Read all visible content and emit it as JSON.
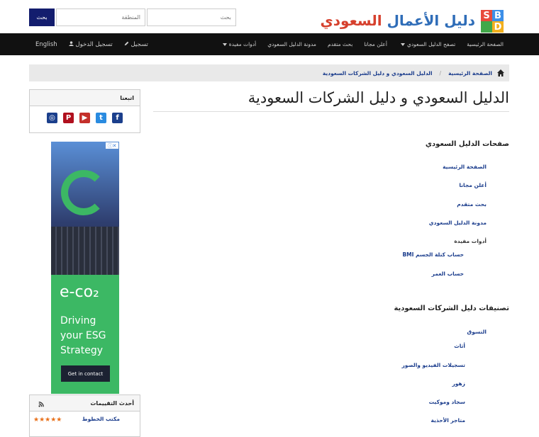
{
  "header": {
    "logo_part1": "دليل الأعمال",
    "logo_part2": "السعودي",
    "logo_letters": [
      "S",
      "B",
      "D",
      ""
    ],
    "search": {
      "query_placeholder": "بحث",
      "region_placeholder": "المنطقة",
      "button_label": "بحث"
    }
  },
  "nav": {
    "right_items": [
      {
        "label": "الصفحة الرئيسية",
        "dropdown": false
      },
      {
        "label": "تصفح الدليل السعودي",
        "dropdown": true
      },
      {
        "label": "أعلن مجانا",
        "dropdown": false
      },
      {
        "label": "بحث متقدم",
        "dropdown": false
      },
      {
        "label": "مدونة الدليل السعودي",
        "dropdown": false
      },
      {
        "label": "أدوات مفيدة",
        "dropdown": true
      }
    ],
    "english": "English",
    "login": "تسجيل الدخول",
    "register": "تسجيل"
  },
  "breadcrumb": {
    "home": "الصفحة الرئيسية",
    "current": "الدليل السعودي و دليل الشركات السعودية"
  },
  "main": {
    "title": "الدليل السعودي و دليل الشركات السعودية",
    "pages_heading": "صفحات الدليل السعودي",
    "pages_links": [
      "الصفحة الرئيسية",
      "أعلن مجانا",
      "بحث متقدم",
      "مدونة الدليل السعودي"
    ],
    "tools_label": "أدوات مفيدة",
    "tools_links": [
      "حساب كتلة الجسم BMI",
      "حساب العمر"
    ],
    "categories_heading": "تصنيفات دليل الشركات السعودية",
    "categories": [
      "التسوق",
      "أثاث",
      "تسجيلات الفيديو والصور",
      "زهور",
      "سجاد وموكيت",
      "متاجر الأحذية"
    ]
  },
  "sidebar": {
    "follow_title": "اتبعنا",
    "social_icons": [
      "instagram-icon",
      "pinterest-icon",
      "youtube-icon",
      "twitter-icon",
      "facebook-icon"
    ],
    "social_glyphs": [
      "◎",
      "P",
      "▶",
      "t",
      "f"
    ],
    "social_colors": [
      "#1b3f8c",
      "#b0101e",
      "#c4302b",
      "#2a8be0",
      "#1b3f8c"
    ],
    "ad": {
      "brand": "e-co₂",
      "headline": "Driving your ESG Strategy",
      "cta": "Get in contact",
      "badge": "ⓘ✕"
    },
    "reviews_title": "أحدث التقييمات",
    "reviews": [
      {
        "name": "مكتب الخطوط",
        "stars": "★★★★★"
      }
    ]
  }
}
